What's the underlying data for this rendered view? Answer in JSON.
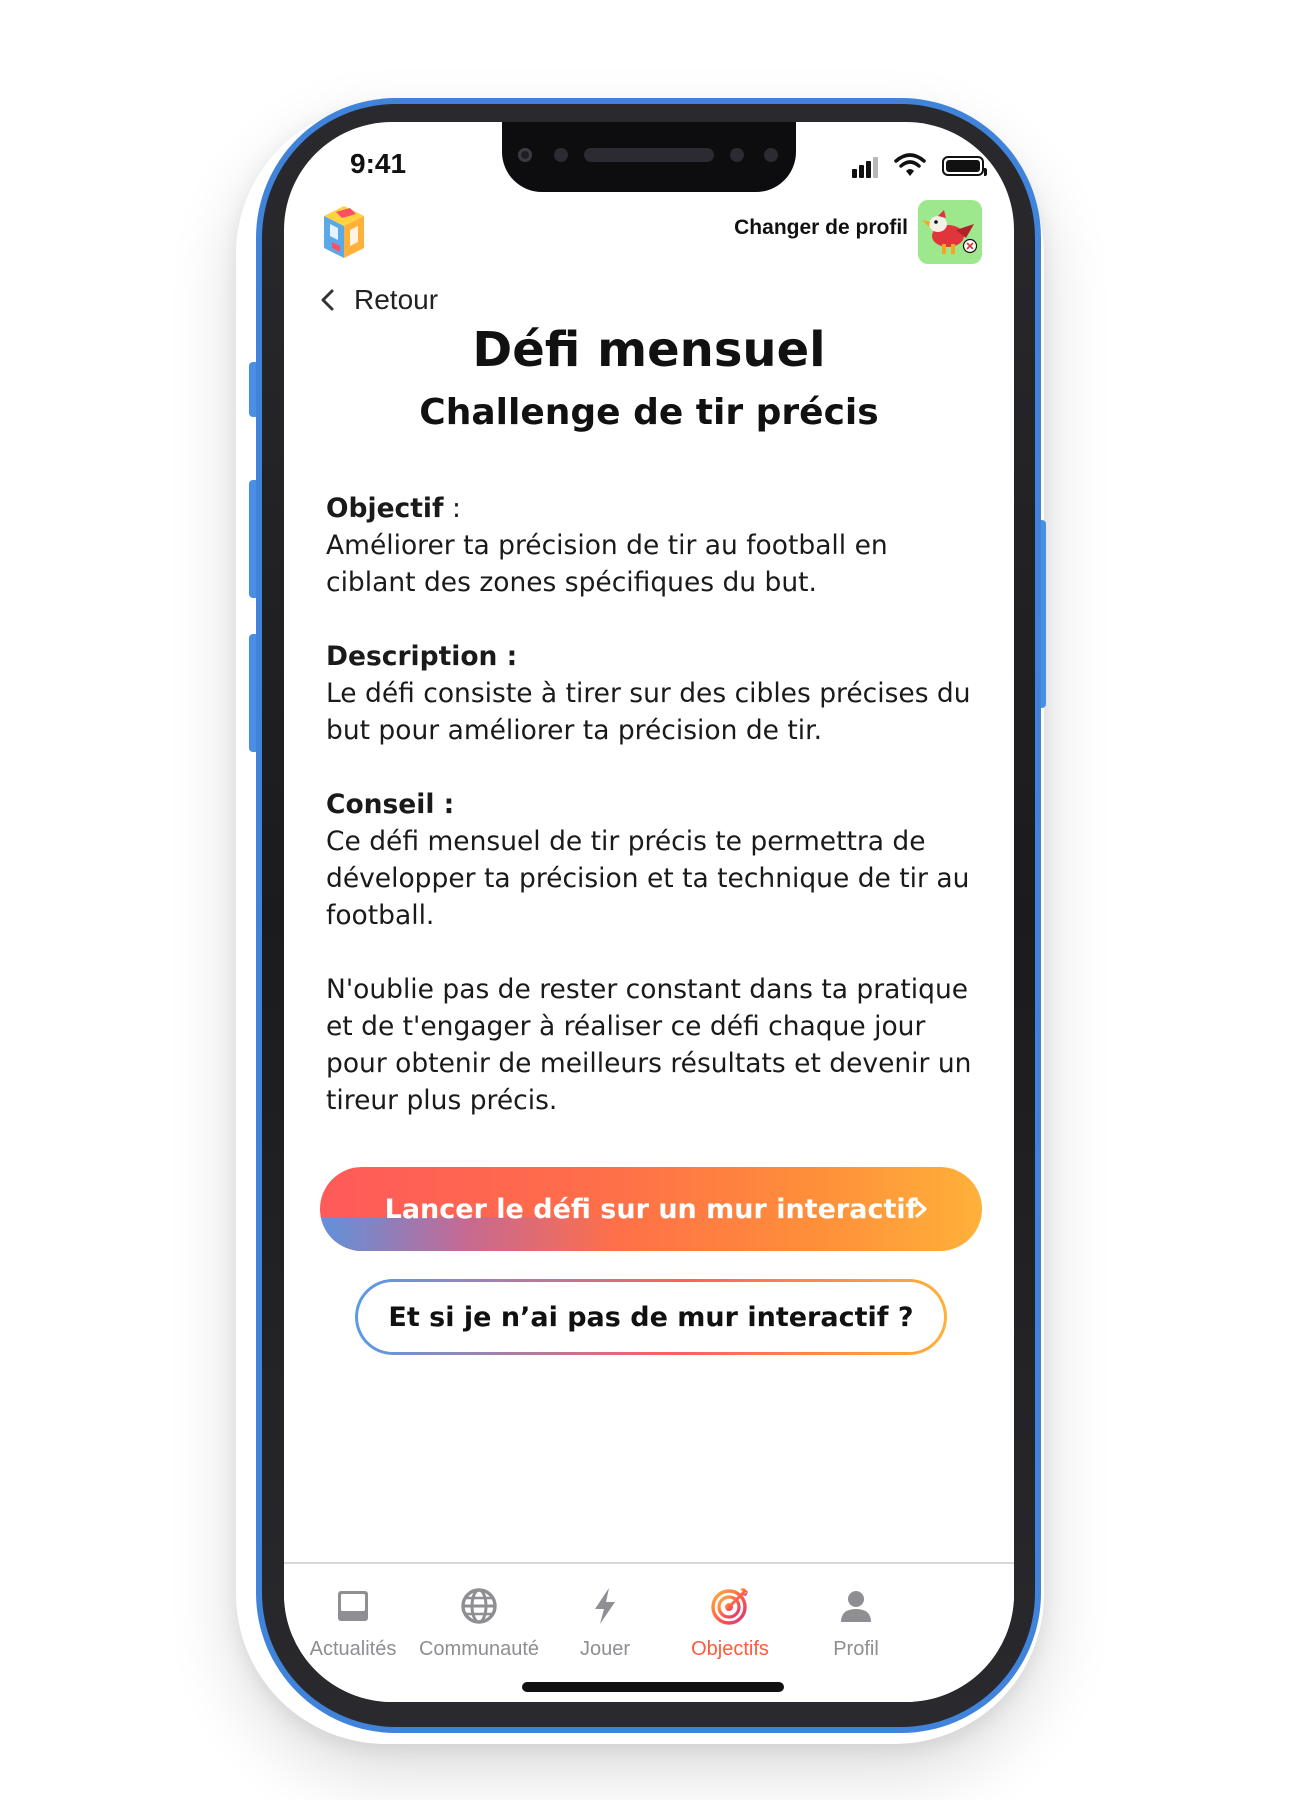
{
  "status_bar": {
    "time": "9:41"
  },
  "header": {
    "change_profile_label": "Changer de profil"
  },
  "nav": {
    "back_label": "Retour"
  },
  "page": {
    "title": "Défi mensuel",
    "subtitle": "Challenge de tir précis"
  },
  "sections": {
    "objectif_label": "Objectif",
    "objectif_colon": " :",
    "objectif_text": "Améliorer ta précision de tir au football en ciblant des zones spécifiques du but.",
    "description_label": "Description :",
    "description_text": "Le défi consiste à tirer sur des cibles précises du but pour améliorer ta précision de tir.",
    "conseil_label": "Conseil :",
    "conseil_text": "Ce défi mensuel de tir précis te permettra de développer ta précision et ta technique de tir au football.",
    "closing_text": "N'oublie pas de rester constant dans ta pratique et de t'engager à réaliser ce défi chaque jour pour obtenir de meilleurs résultats et devenir un tireur plus précis."
  },
  "actions": {
    "primary_label": "Lancer le défi sur un mur interactif",
    "secondary_label": "Et si je n’ai pas de mur interactif ?"
  },
  "tabs": [
    {
      "label": "Actualités",
      "icon": "inbox-icon"
    },
    {
      "label": "Communauté",
      "icon": "globe-icon"
    },
    {
      "label": "Jouer",
      "icon": "bolt-icon"
    },
    {
      "label": "Objectifs",
      "icon": "target-icon",
      "active": true
    },
    {
      "label": "Profil",
      "icon": "user-icon"
    }
  ],
  "colors": {
    "phone_frame": "#3f83db",
    "accent_orange": "#ff5a3c",
    "gradient_start": "#ff5a5a",
    "gradient_end": "#ffb13a",
    "gradient_blue": "#5696e2",
    "inactive_tab": "#8e8e93",
    "avatar_bg": "#9de88c"
  }
}
